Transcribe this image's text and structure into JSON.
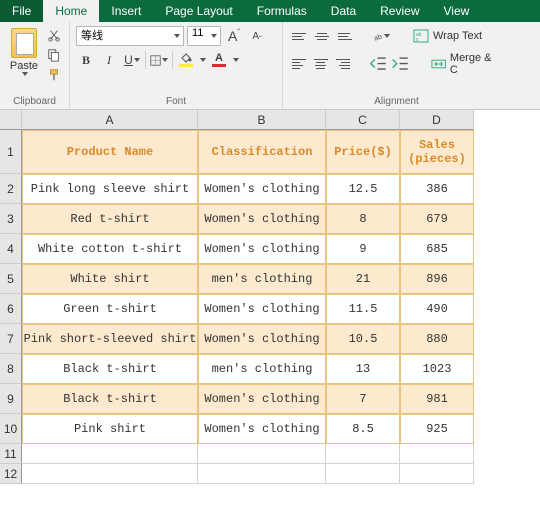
{
  "titlebar": {
    "tabs": [
      "File",
      "Home",
      "Insert",
      "Page Layout",
      "Formulas",
      "Data",
      "Review",
      "View"
    ],
    "active_index": 1
  },
  "ribbon": {
    "clipboard": {
      "paste": "Paste",
      "label": "Clipboard"
    },
    "font": {
      "name": "等线",
      "size": "11",
      "bold": "B",
      "italic": "I",
      "underline": "U",
      "incA": "A",
      "decA": "A",
      "label": "Font",
      "fill_color": "#ffeb3b",
      "font_color": "#d32f2f"
    },
    "alignment": {
      "abc": "abc",
      "wrap": "Wrap Text",
      "merge": "Merge & C",
      "label": "Alignment"
    }
  },
  "sheet": {
    "cols": [
      "A",
      "B",
      "C",
      "D"
    ],
    "rows": [
      "1",
      "2",
      "3",
      "4",
      "5",
      "6",
      "7",
      "8",
      "9",
      "10",
      "11",
      "12"
    ],
    "headers": [
      "Product Name",
      "Classification",
      "Price($)",
      "Sales (pieces)"
    ],
    "data": [
      [
        "Pink long sleeve shirt",
        "Women's clothing",
        "12.5",
        "386"
      ],
      [
        "Red t-shirt",
        "Women's clothing",
        "8",
        "679"
      ],
      [
        "White cotton t-shirt",
        "Women's clothing",
        "9",
        "685"
      ],
      [
        "White shirt",
        "men's clothing",
        "21",
        "896"
      ],
      [
        "Green t-shirt",
        "Women's clothing",
        "11.5",
        "490"
      ],
      [
        "Pink short-sleeved shirt",
        "Women's clothing",
        "10.5",
        "880"
      ],
      [
        "Black t-shirt",
        "men's clothing",
        "13",
        "1023"
      ],
      [
        "Black t-shirt",
        "Women's clothing",
        "7",
        "981"
      ],
      [
        "Pink shirt",
        "Women's clothing",
        "8.5",
        "925"
      ]
    ]
  },
  "chart_data": {
    "type": "table",
    "title": "",
    "columns": [
      "Product Name",
      "Classification",
      "Price($)",
      "Sales (pieces)"
    ],
    "rows": [
      {
        "Product Name": "Pink long sleeve shirt",
        "Classification": "Women's clothing",
        "Price($)": 12.5,
        "Sales (pieces)": 386
      },
      {
        "Product Name": "Red t-shirt",
        "Classification": "Women's clothing",
        "Price($)": 8,
        "Sales (pieces)": 679
      },
      {
        "Product Name": "White cotton t-shirt",
        "Classification": "Women's clothing",
        "Price($)": 9,
        "Sales (pieces)": 685
      },
      {
        "Product Name": "White shirt",
        "Classification": "men's clothing",
        "Price($)": 21,
        "Sales (pieces)": 896
      },
      {
        "Product Name": "Green t-shirt",
        "Classification": "Women's clothing",
        "Price($)": 11.5,
        "Sales (pieces)": 490
      },
      {
        "Product Name": "Pink short-sleeved shirt",
        "Classification": "Women's clothing",
        "Price($)": 10.5,
        "Sales (pieces)": 880
      },
      {
        "Product Name": "Black t-shirt",
        "Classification": "men's clothing",
        "Price($)": 13,
        "Sales (pieces)": 1023
      },
      {
        "Product Name": "Black t-shirt",
        "Classification": "Women's clothing",
        "Price($)": 7,
        "Sales (pieces)": 981
      },
      {
        "Product Name": "Pink shirt",
        "Classification": "Women's clothing",
        "Price($)": 8.5,
        "Sales (pieces)": 925
      }
    ]
  }
}
